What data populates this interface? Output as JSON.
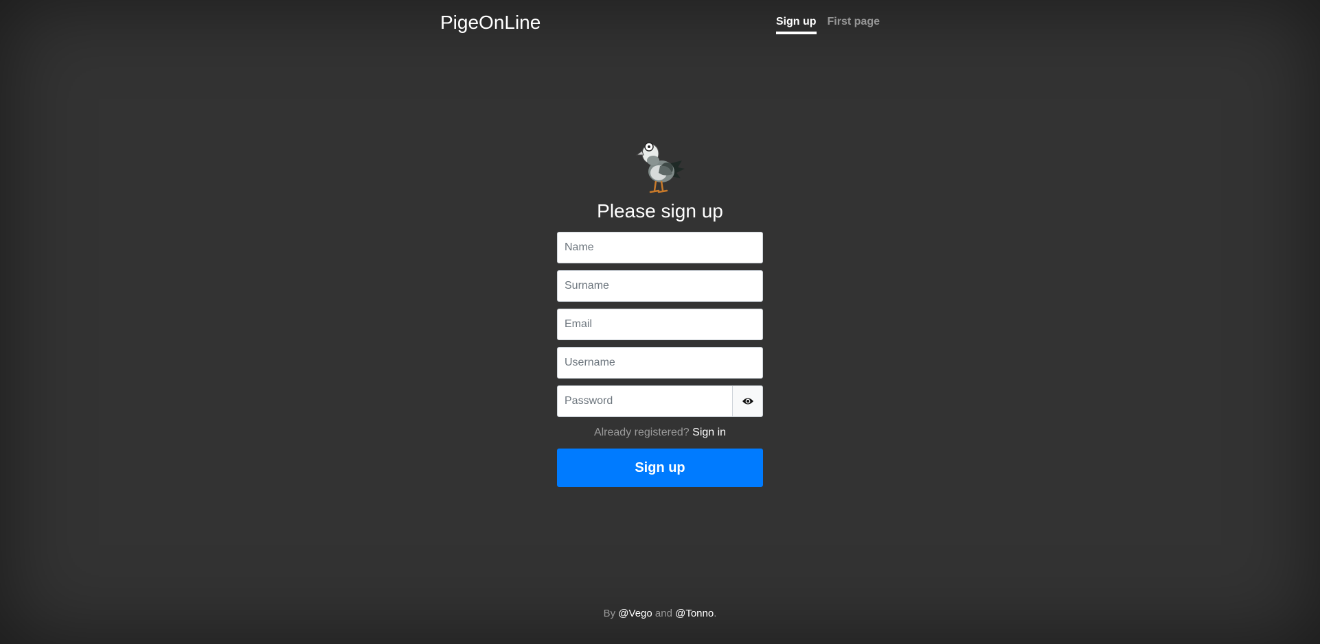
{
  "header": {
    "brand": "PigeOnLine",
    "nav": [
      {
        "label": "Sign up",
        "active": true
      },
      {
        "label": "First page",
        "active": false
      }
    ]
  },
  "form": {
    "logo_icon": "pigeon-icon",
    "heading": "Please sign up",
    "fields": {
      "name_placeholder": "Name",
      "surname_placeholder": "Surname",
      "email_placeholder": "Email",
      "username_placeholder": "Username",
      "password_placeholder": "Password"
    },
    "password_toggle_icon": "eye-icon",
    "already_text": "Already registered?",
    "signin_link": "Sign in",
    "submit_label": "Sign up"
  },
  "footer": {
    "by": "By",
    "author1": "@Vego",
    "and": "and",
    "author2": "@Tonno",
    "end": "."
  },
  "colors": {
    "background": "#333333",
    "accent": "#007bff"
  }
}
